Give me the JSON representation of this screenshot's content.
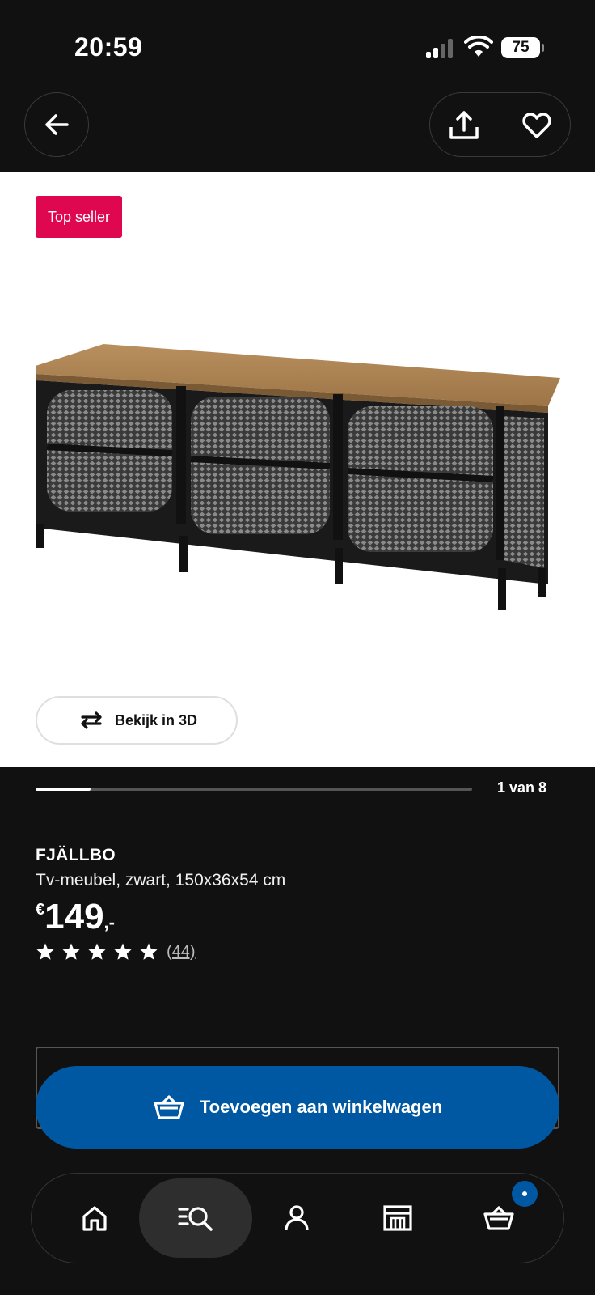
{
  "status_bar": {
    "time": "20:59",
    "battery": "75"
  },
  "header": {
    "back_icon": "arrow-left-icon",
    "share_icon": "share-icon",
    "favorite_icon": "heart-icon"
  },
  "gallery": {
    "badge": "Top seller",
    "view_3d_label": "Bekijk in 3D",
    "view_3d_icon": "rotate-3d-icon",
    "counter": "1 van 8",
    "current_index": 1,
    "total": 8
  },
  "product": {
    "name": "FJÄLLBO",
    "description": "Tv-meubel, zwart, 150x36x54 cm",
    "price_currency": "€",
    "price_amount": "149",
    "price_suffix": ",-",
    "rating_stars": 5,
    "review_count": "(44)"
  },
  "cart_button": {
    "label": "Toevoegen aan winkelwagen",
    "icon": "basket-icon"
  },
  "bottom_nav": {
    "items": [
      {
        "name": "home",
        "icon": "home-icon"
      },
      {
        "name": "search",
        "icon": "search-list-icon",
        "active": true
      },
      {
        "name": "profile",
        "icon": "person-icon"
      },
      {
        "name": "store",
        "icon": "store-icon"
      },
      {
        "name": "cart",
        "icon": "basket-icon",
        "badge": true
      }
    ]
  },
  "colors": {
    "background": "#111111",
    "accent_blue": "#0058a3",
    "badge_red": "#e00751"
  }
}
